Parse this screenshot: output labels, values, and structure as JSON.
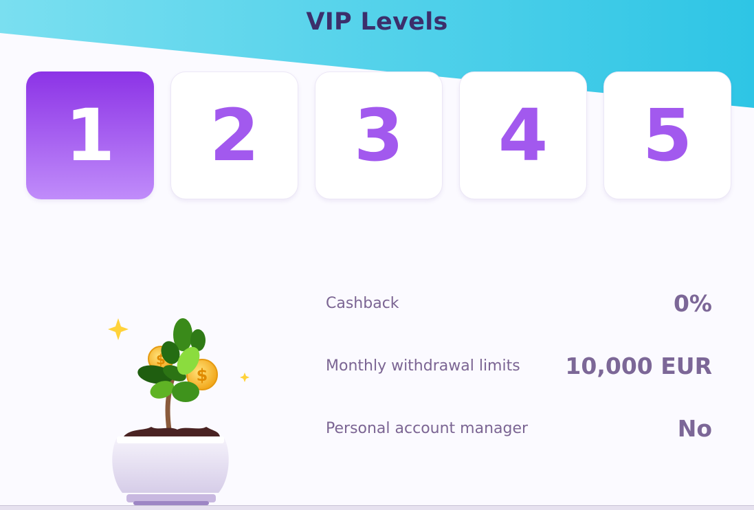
{
  "header": {
    "title": "VIP Levels"
  },
  "levels": {
    "selected": "1",
    "tabs": [
      {
        "label": "1"
      },
      {
        "label": "2"
      },
      {
        "label": "3"
      },
      {
        "label": "4"
      },
      {
        "label": "5"
      }
    ]
  },
  "benefits": [
    {
      "label": "Cashback",
      "value": "0%"
    },
    {
      "label": "Monthly withdrawal limits",
      "value": "10,000 EUR"
    },
    {
      "label": "Personal account manager",
      "value": "No"
    }
  ],
  "colors": {
    "header_gradient_start": "#72dced",
    "header_gradient_end": "#2ec7e6",
    "accent_purple": "#a259ee",
    "active_tab_top": "#8c33e6",
    "active_tab_bottom": "#c08cfa",
    "title_text": "#3c2f6b"
  },
  "icons": {
    "illustration": "money-tree-plant-icon",
    "sparkle": "sparkle-icon",
    "coin": "dollar-coin-icon"
  }
}
